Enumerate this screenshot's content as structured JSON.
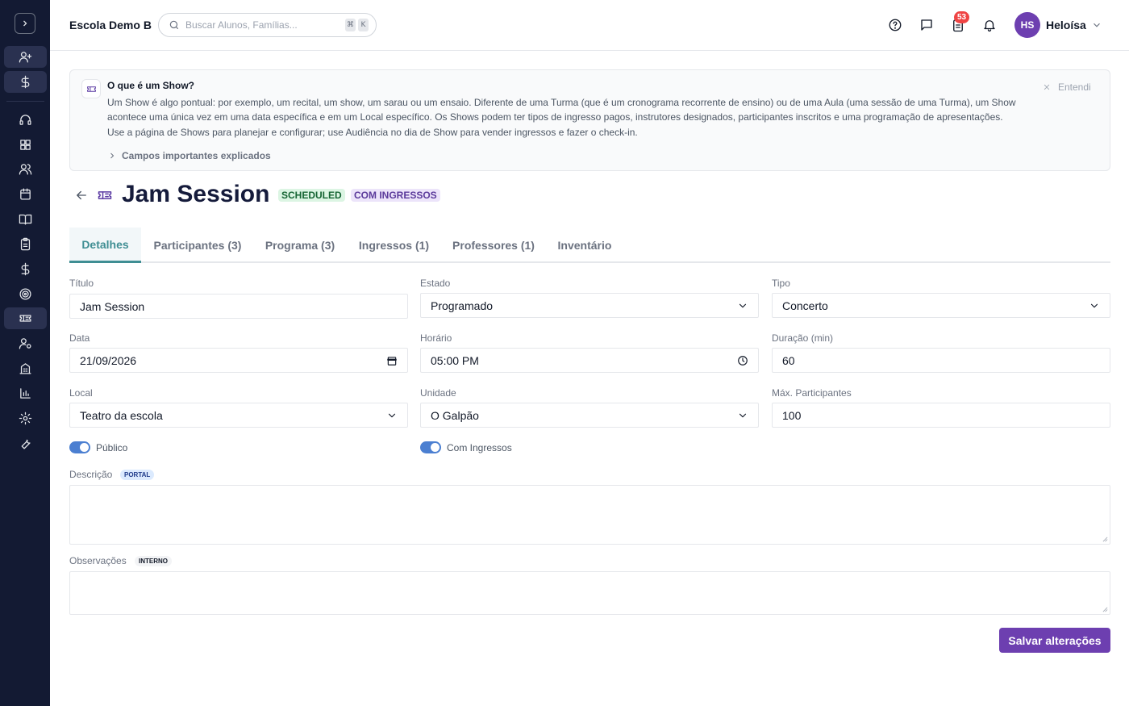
{
  "topbar": {
    "school_name": "Escola Demo B",
    "search_placeholder": "Buscar Alunos, Famílias...",
    "shortcut_keys": [
      "⌘",
      "K"
    ],
    "notifications_badge": "53",
    "user_initials": "HS",
    "user_name": "Heloísa"
  },
  "info_banner": {
    "title": "O que é um Show?",
    "body": "Um Show é algo pontual: por exemplo, um recital, um show, um sarau ou um ensaio. Diferente de uma Turma (que é um cronograma recorrente de ensino) ou de uma Aula (uma sessão de uma Turma), um Show acontece uma única vez em uma data específica e em um Local específico. Os Shows podem ter tipos de ingresso pagos, instrutores designados, participantes inscritos e uma programação de apresentações. Use a página de Shows para planejar e configurar; use Audiência no dia de Show para vender ingressos e fazer o check-in.",
    "expand_label": "Campos importantes explicados",
    "dismiss_label": "Entendi"
  },
  "page": {
    "title": "Jam Session",
    "status_tag": "SCHEDULED",
    "ticket_tag": "COM INGRESSOS"
  },
  "tabs": [
    {
      "label": "Detalhes"
    },
    {
      "label": "Participantes (3)"
    },
    {
      "label": "Programa (3)"
    },
    {
      "label": "Ingressos (1)"
    },
    {
      "label": "Professores (1)"
    },
    {
      "label": "Inventário"
    }
  ],
  "form": {
    "titulo_label": "Título",
    "titulo_value": "Jam Session",
    "estado_label": "Estado",
    "estado_value": "Programado",
    "tipo_label": "Tipo",
    "tipo_value": "Concerto",
    "data_label": "Data",
    "data_value": "21/09/2026",
    "horario_label": "Horário",
    "horario_value": "05:00 PM",
    "duracao_label": "Duração (min)",
    "duracao_value": "60",
    "local_label": "Local",
    "local_value": "Teatro da escola",
    "unidade_label": "Unidade",
    "unidade_value": "O Galpão",
    "max_label": "Máx. Participantes",
    "max_value": "100",
    "publico_label": "Público",
    "publico_on": true,
    "ingressos_label": "Com Ingressos",
    "ingressos_on": true,
    "descricao_label": "Descrição",
    "descricao_tag": "PORTAL",
    "descricao_value": "",
    "observacoes_label": "Observações",
    "observacoes_tag": "INTERNO",
    "observacoes_value": "",
    "save_label": "Salvar alterações"
  },
  "colors": {
    "sidebar_bg": "#131a33",
    "accent_purple": "#6d3fb0",
    "tab_active": "#3f8e93",
    "toggle_on": "#4b7fd1"
  },
  "sidebar_icons": [
    "chevron-right-icon",
    "user-plus-icon",
    "dollar-icon",
    "headset-icon",
    "dashboard-icon",
    "users-icon",
    "calendar-icon",
    "book-icon",
    "clipboard-icon",
    "dollar-icon",
    "target-icon",
    "ticket-icon",
    "user-gear-icon",
    "building-icon",
    "bar-chart-icon",
    "settings-icon",
    "wrench-icon"
  ]
}
